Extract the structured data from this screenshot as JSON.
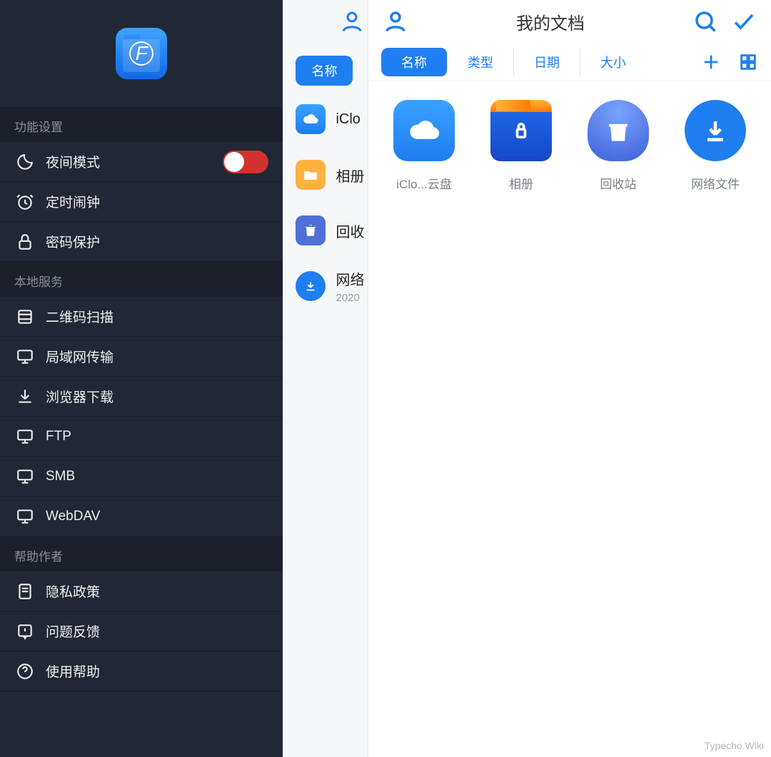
{
  "left": {
    "sections": {
      "settings_title": "功能设置",
      "local_title": "本地服务",
      "help_title": "帮助作者"
    },
    "night_mode": {
      "label": "夜间模式",
      "on": true
    },
    "alarm": "定时闹钟",
    "lock": "密码保护",
    "qr": "二维码扫描",
    "lan": "局域网传输",
    "browser_dl": "浏览器下载",
    "ftp": "FTP",
    "smb": "SMB",
    "webdav": "WebDAV",
    "privacy": "隐私政策",
    "feedback": "问题反馈",
    "help": "使用帮助"
  },
  "mid": {
    "tab_name": "名称",
    "items": [
      {
        "label": "iClo",
        "sub": ""
      },
      {
        "label": "相册",
        "sub": ""
      },
      {
        "label": "回收",
        "sub": ""
      },
      {
        "label": "网络",
        "sub": "2020"
      }
    ]
  },
  "right": {
    "title": "我的文档",
    "tabs": {
      "name": "名称",
      "type": "类型",
      "date": "日期",
      "size": "大小"
    },
    "cards": {
      "cloud": "iClo...云盘",
      "album": "相册",
      "bin": "回收站",
      "net": "网络文件"
    }
  },
  "watermark": "Typecho.Wiki"
}
